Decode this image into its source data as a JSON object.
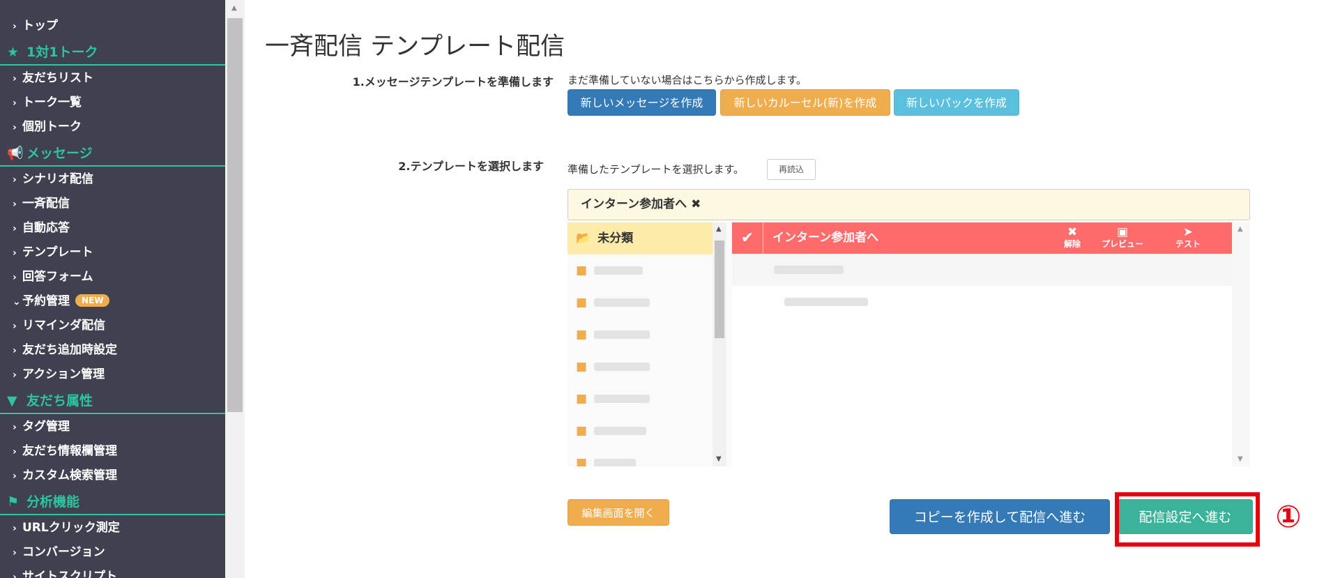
{
  "sidebar": {
    "items": [
      {
        "type": "item",
        "label": "トップ"
      },
      {
        "type": "head",
        "label": "1対1トーク",
        "icon": "star-icon"
      },
      {
        "type": "item",
        "label": "友だちリスト"
      },
      {
        "type": "item",
        "label": "トーク一覧"
      },
      {
        "type": "item",
        "label": "個別トーク"
      },
      {
        "type": "head",
        "label": "メッセージ",
        "icon": "megaphone-icon"
      },
      {
        "type": "item",
        "label": "シナリオ配信"
      },
      {
        "type": "item",
        "label": "一斉配信"
      },
      {
        "type": "item",
        "label": "自動応答"
      },
      {
        "type": "item",
        "label": "テンプレート"
      },
      {
        "type": "item",
        "label": "回答フォーム"
      },
      {
        "type": "item",
        "label": "予約管理",
        "badge": "NEW",
        "expanded": true
      },
      {
        "type": "item",
        "label": "リマインダ配信"
      },
      {
        "type": "item",
        "label": "友だち追加時設定"
      },
      {
        "type": "item",
        "label": "アクション管理"
      },
      {
        "type": "head",
        "label": "友だち属性",
        "icon": "filter-icon"
      },
      {
        "type": "item",
        "label": "タグ管理"
      },
      {
        "type": "item",
        "label": "友だち情報欄管理"
      },
      {
        "type": "item",
        "label": "カスタム検索管理"
      },
      {
        "type": "head",
        "label": "分析機能",
        "icon": "flag-icon"
      },
      {
        "type": "item",
        "label": "URLクリック測定"
      },
      {
        "type": "item",
        "label": "コンバージョン"
      },
      {
        "type": "item",
        "label": "サイトスクリプト"
      }
    ]
  },
  "main": {
    "title": "一斉配信 テンプレート配信",
    "step1": {
      "label": "1.メッセージテンプレートを準備します",
      "note": "まだ準備していない場合はこちらから作成します。",
      "buttons": {
        "new_message": "新しいメッセージを作成",
        "new_carousel": "新しいカルーセル(新)を作成",
        "new_pack": "新しいパックを作成"
      }
    },
    "step2": {
      "label": "2.テンプレートを選択します",
      "note": "準備したテンプレートを選択します。",
      "reload": "再読込"
    },
    "selected_template": "インターン参加者へ ✖",
    "folders": {
      "active": "未分類"
    },
    "template_header": {
      "name": "インターン参加者へ",
      "actions": {
        "clear": "解除",
        "preview": "プレビュー",
        "test": "テスト"
      }
    },
    "bottom": {
      "open_editor": "編集画面を開く",
      "copy_and_send": "コピーを作成して配信へ進む",
      "go_settings": "配信設定へ進む",
      "annotation": "①"
    }
  },
  "colors": {
    "sidebar_bg": "#3f4150",
    "sidebar_accent": "#2ec4a0",
    "header_red": "#ff6b6b",
    "highlight_red": "#e8000c"
  }
}
